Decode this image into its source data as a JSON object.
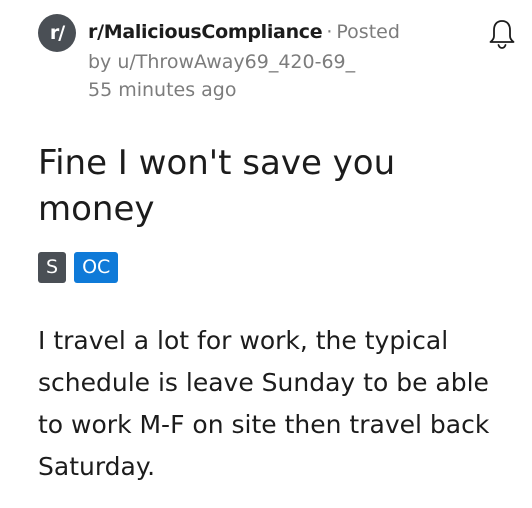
{
  "header": {
    "avatar_text": "r/",
    "subreddit": "r/MaliciousCompliance",
    "separator": "·",
    "posted_label": "Posted",
    "author_line": "by u/ThrowAway69_420-69_",
    "time_ago": "55 minutes ago",
    "bell_icon": "bell-icon"
  },
  "post": {
    "title": "Fine I won't save you money",
    "flairs": [
      "S",
      "OC"
    ],
    "body": "I travel a lot for work, the typical schedule is leave Sunday to be able to work M-F on site then travel back Saturday."
  },
  "colors": {
    "avatar_bg": "#4a4f55",
    "flair_s_bg": "#4a4f55",
    "flair_oc_bg": "#0f7ad8",
    "muted_text": "#7c7c7c"
  }
}
